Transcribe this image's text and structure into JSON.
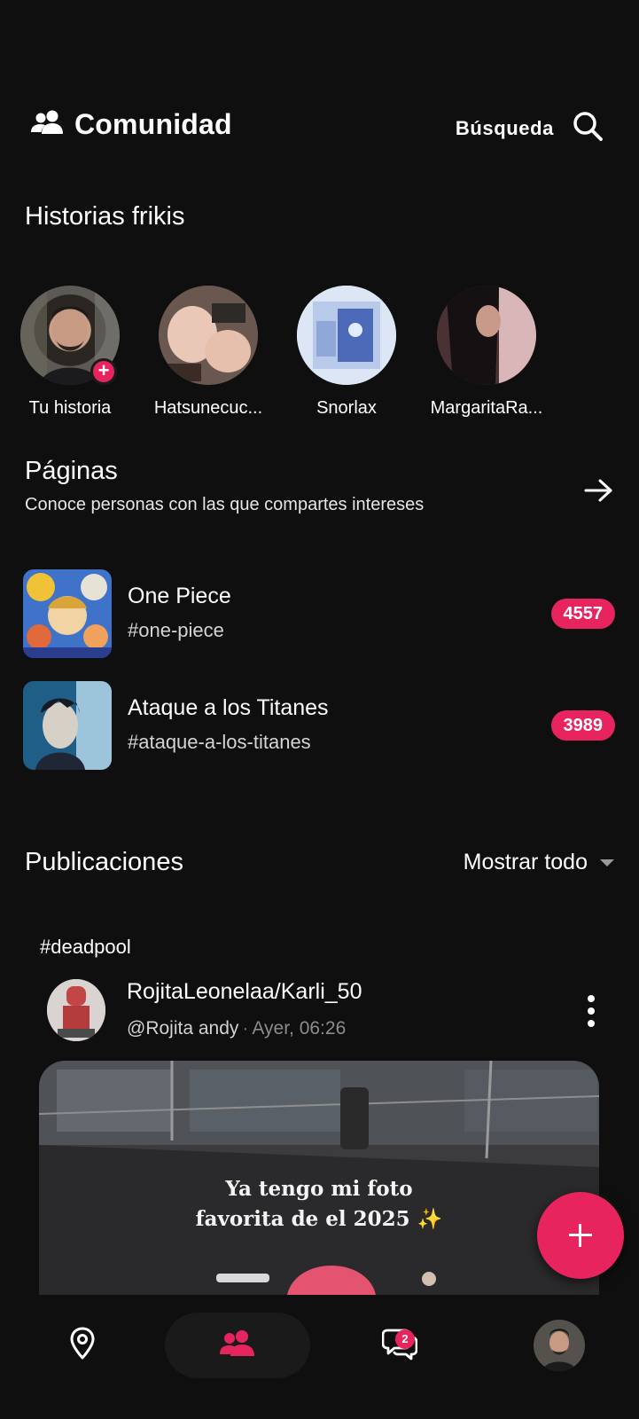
{
  "header": {
    "title": "Comunidad",
    "search_label": "Búsqueda",
    "icons": {
      "community": "people-icon",
      "search": "search-icon"
    }
  },
  "stories": {
    "title": "Historias frikis",
    "items": [
      {
        "label": "Tu historia",
        "is_own": true
      },
      {
        "label": "Hatsunecuc..."
      },
      {
        "label": "Snorlax"
      },
      {
        "label": "MargaritaRa..."
      }
    ]
  },
  "pages": {
    "title": "Páginas",
    "subtitle": "Conoce personas con las que compartes intereses",
    "items": [
      {
        "name": "One Piece",
        "tag": "#one-piece",
        "count": "4557"
      },
      {
        "name": "Ataque a los Titanes",
        "tag": "#ataque-a-los-titanes",
        "count": "3989"
      }
    ]
  },
  "publications": {
    "title": "Publicaciones",
    "filter_label": "Mostrar todo",
    "post": {
      "tag": "#deadpool",
      "author": "RojitaLeonelaa/Karli_50",
      "handle": "@Rojita andy",
      "time": "Ayer, 06:26",
      "caption_line1": "Ya tengo mi foto",
      "caption_line2": "favorita de el 2025 ✨"
    }
  },
  "bottom_nav": {
    "messages_badge": "2",
    "active": "community"
  },
  "colors": {
    "accent": "#e8245f",
    "background": "#0f0f10",
    "text": "#ffffff",
    "muted": "#8c8c8c"
  }
}
